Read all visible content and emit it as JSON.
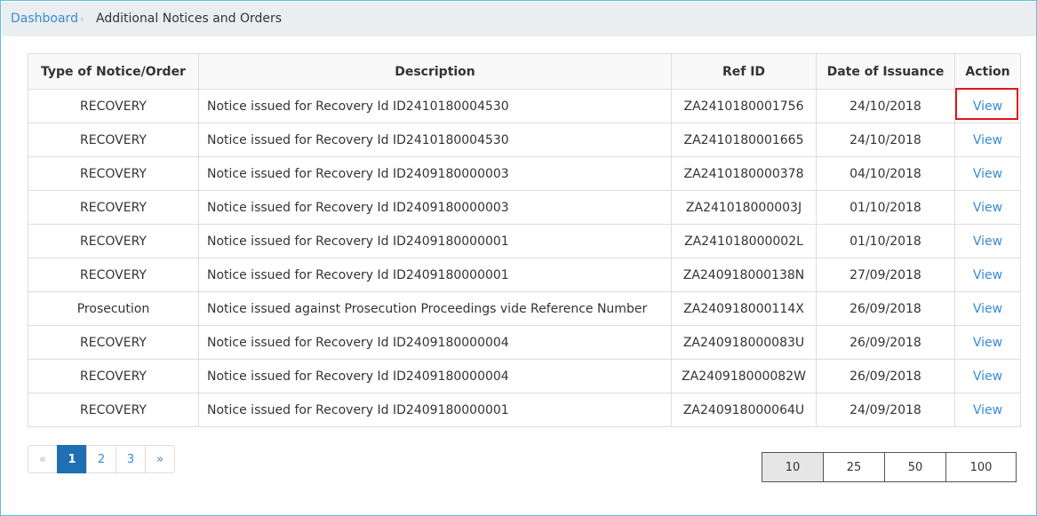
{
  "breadcrumb": {
    "home": "Dashboard",
    "separator": "›",
    "current": "Additional Notices and Orders"
  },
  "table": {
    "headers": {
      "type": "Type of Notice/Order",
      "description": "Description",
      "ref_id": "Ref ID",
      "date": "Date of Issuance",
      "action": "Action"
    },
    "rows": [
      {
        "type": "RECOVERY",
        "description": "Notice issued for Recovery Id ID2410180004530",
        "ref_id": "ZA2410180001756",
        "date": "24/10/2018",
        "action": "View"
      },
      {
        "type": "RECOVERY",
        "description": "Notice issued for Recovery Id ID2410180004530",
        "ref_id": "ZA2410180001665",
        "date": "24/10/2018",
        "action": "View"
      },
      {
        "type": "RECOVERY",
        "description": "Notice issued for Recovery Id ID2409180000003",
        "ref_id": "ZA2410180000378",
        "date": "04/10/2018",
        "action": "View"
      },
      {
        "type": "RECOVERY",
        "description": "Notice issued for Recovery Id ID2409180000003",
        "ref_id": "ZA241018000003J",
        "date": "01/10/2018",
        "action": "View"
      },
      {
        "type": "RECOVERY",
        "description": "Notice issued for Recovery Id ID2409180000001",
        "ref_id": "ZA241018000002L",
        "date": "01/10/2018",
        "action": "View"
      },
      {
        "type": "RECOVERY",
        "description": "Notice issued for Recovery Id ID2409180000001",
        "ref_id": "ZA240918000138N",
        "date": "27/09/2018",
        "action": "View"
      },
      {
        "type": "Prosecution",
        "description": "Notice issued against Prosecution Proceedings vide Reference Number",
        "ref_id": "ZA240918000114X",
        "date": "26/09/2018",
        "action": "View"
      },
      {
        "type": "RECOVERY",
        "description": "Notice issued for Recovery Id ID2409180000004",
        "ref_id": "ZA240918000083U",
        "date": "26/09/2018",
        "action": "View"
      },
      {
        "type": "RECOVERY",
        "description": "Notice issued for Recovery Id ID2409180000004",
        "ref_id": "ZA240918000082W",
        "date": "26/09/2018",
        "action": "View"
      },
      {
        "type": "RECOVERY",
        "description": "Notice issued for Recovery Id ID2409180000001",
        "ref_id": "ZA240918000064U",
        "date": "24/09/2018",
        "action": "View"
      }
    ]
  },
  "pagination": {
    "prev": "«",
    "pages": [
      "1",
      "2",
      "3"
    ],
    "active_page": "1",
    "next": "»"
  },
  "page_size": {
    "options": [
      "10",
      "25",
      "50",
      "100"
    ],
    "selected": "10"
  },
  "colors": {
    "link": "#3a8ad1",
    "active_page": "#1f6fb3",
    "highlight": "#e0161c",
    "frame_border": "#5bc0de"
  }
}
